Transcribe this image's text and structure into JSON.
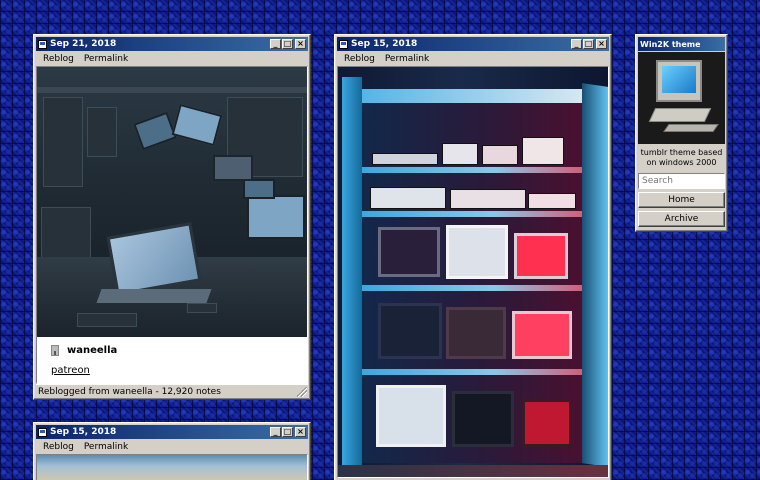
{
  "posts": [
    {
      "date": "Sep 21, 2018",
      "menu": {
        "reblog": "Reblog",
        "permalink": "Permalink"
      },
      "author": "waneella",
      "link": "patreon",
      "status": "Reblogged from waneella - 12,920 notes"
    },
    {
      "date": "Sep 15, 2018",
      "menu": {
        "reblog": "Reblog",
        "permalink": "Permalink"
      }
    },
    {
      "date": "Sep 15, 2018",
      "menu": {
        "reblog": "Reblog",
        "permalink": "Permalink"
      }
    }
  ],
  "sidebar": {
    "title": "Win2K theme",
    "description": "tumblr theme based on windows 2000",
    "search_placeholder": "Search",
    "home_label": "Home",
    "archive_label": "Archive"
  },
  "window_buttons": {
    "minimize": "_",
    "maximize": "□",
    "close": "×"
  },
  "icons": {
    "window_icon": "window-app-icon",
    "avatar": "user-avatar-icon",
    "computer": "computer-illustration"
  },
  "colors": {
    "desktop": "#0c1a7a",
    "titlebar_start": "#0a246a",
    "titlebar_end": "#3a6ea5",
    "window_face": "#d4d0c8"
  }
}
